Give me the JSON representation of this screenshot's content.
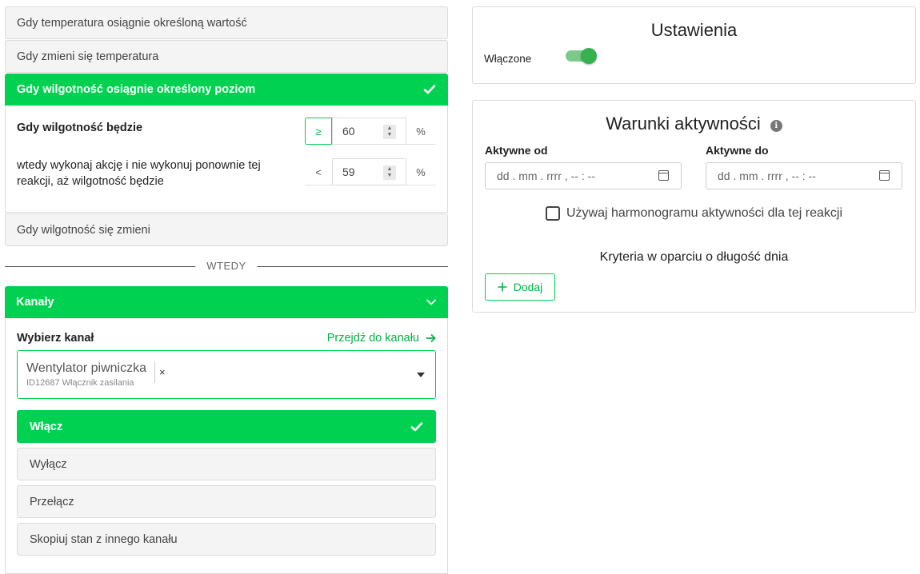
{
  "triggers": {
    "items_before": [
      "Gdy temperatura osiągnie określoną wartość",
      "Gdy zmieni się temperatura"
    ],
    "active": "Gdy wilgotność osiągnie określony poziom",
    "condition": {
      "row1_label": "Gdy wilgotność będzie",
      "row1_operator": "≥",
      "row1_value": "60",
      "row1_unit": "%",
      "row2_label": "wtedy wykonaj akcję i nie wykonuj ponownie tej reakcji, aż wilgotność będzie",
      "row2_operator": "<",
      "row2_value": "59",
      "row2_unit": "%"
    },
    "item_after": "Gdy wilgotność się zmieni"
  },
  "divider_label": "WTEDY",
  "channels": {
    "header": "Kanały",
    "select_label": "Wybierz kanał",
    "go_link": "Przejdź do kanału",
    "selected_name": "Wentylator piwniczka",
    "selected_sub": "ID12687 Włącznik zasilania",
    "clear": "×",
    "actions": [
      {
        "label": "Włącz",
        "active": true
      },
      {
        "label": "Wyłącz",
        "active": false
      },
      {
        "label": "Przełącz",
        "active": false
      },
      {
        "label": "Skopiuj stan z innego kanału",
        "active": false
      }
    ]
  },
  "settings": {
    "title": "Ustawienia",
    "enabled_label": "Włączone",
    "enabled": true
  },
  "conditions": {
    "title": "Warunki aktywności",
    "from_label": "Aktywne od",
    "to_label": "Aktywne do",
    "date_placeholder": "dd . mm . rrrr ,  -- : --",
    "schedule_label": "Używaj harmonogramu aktywności dla tej reakcji",
    "criteria_label": "Kryteria w oparciu o długość dnia",
    "add_label": "Dodaj"
  },
  "colors": {
    "accent": "#00d150",
    "toggle_track": "#7cc98a",
    "toggle_knob": "#35b24f"
  }
}
